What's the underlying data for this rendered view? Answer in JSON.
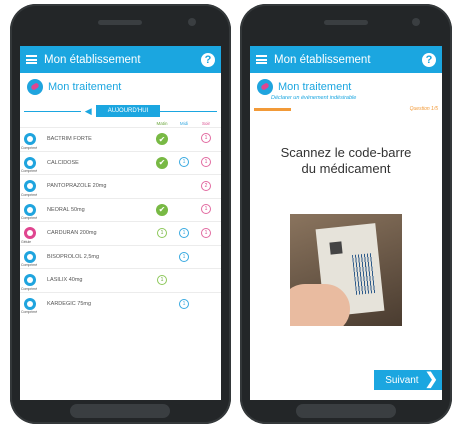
{
  "left_screen": {
    "appbar_title": "Mon établissement",
    "help_glyph": "?",
    "section_title": "Mon traitement",
    "today_label": "AUJOURD'HUI",
    "column_heads": [
      "Matin",
      "Midi",
      "Soir"
    ],
    "medications": [
      {
        "name": "BACTRIM FORTE",
        "sub": "Comprimé",
        "slots": [
          "check",
          "",
          "1p"
        ],
        "variant": "plain"
      },
      {
        "name": "CALCIDOSE",
        "sub": "Comprimé",
        "slots": [
          "check",
          "1b",
          "1p"
        ],
        "variant": "plain"
      },
      {
        "name": "PANTOPRAZOLE 20mg",
        "sub": "Comprimé",
        "slots": [
          "",
          "",
          "2p"
        ],
        "variant": "plain"
      },
      {
        "name": "NEORAL 50mg",
        "sub": "Comprimé",
        "slots": [
          "check",
          "",
          "1p"
        ],
        "variant": "plain"
      },
      {
        "name": "CARDURAN 200mg",
        "sub": "Gélule",
        "slots": [
          "1g",
          "1b",
          "1p"
        ],
        "variant": "split"
      },
      {
        "name": "BISOPROLOL 2,5mg",
        "sub": "Comprimé",
        "slots": [
          "",
          "1b",
          ""
        ],
        "variant": "plain"
      },
      {
        "name": "LASILIX 40mg",
        "sub": "Comprimé",
        "slots": [
          "1g",
          "",
          ""
        ],
        "variant": "plain"
      },
      {
        "name": "KARDEGIC 75mg",
        "sub": "Comprimé",
        "slots": [
          "",
          "1b",
          ""
        ],
        "variant": "plain"
      }
    ]
  },
  "right_screen": {
    "appbar_title": "Mon établissement",
    "help_glyph": "?",
    "section_title": "Mon traitement",
    "section_subtitle": "Déclarer un événement indésirable",
    "progress_label": "Question 1/5",
    "progress_fraction": 0.2,
    "scan_line1": "Scannez le code-barre",
    "scan_line2": "du médicament",
    "next_label": "Suivant",
    "next_glyph": "❯"
  },
  "icons": {
    "menu": "hamburger-icon",
    "help": "help-icon",
    "brand": "pill-logo-icon",
    "taken": "check-icon",
    "back": "arrow-left-icon"
  },
  "colors": {
    "primary": "#1ba6e0",
    "taken": "#78b944",
    "dose_green": "#8dc85a",
    "dose_blue": "#38a9e0",
    "dose_pink": "#e26aa0",
    "progress": "#f29a38"
  }
}
